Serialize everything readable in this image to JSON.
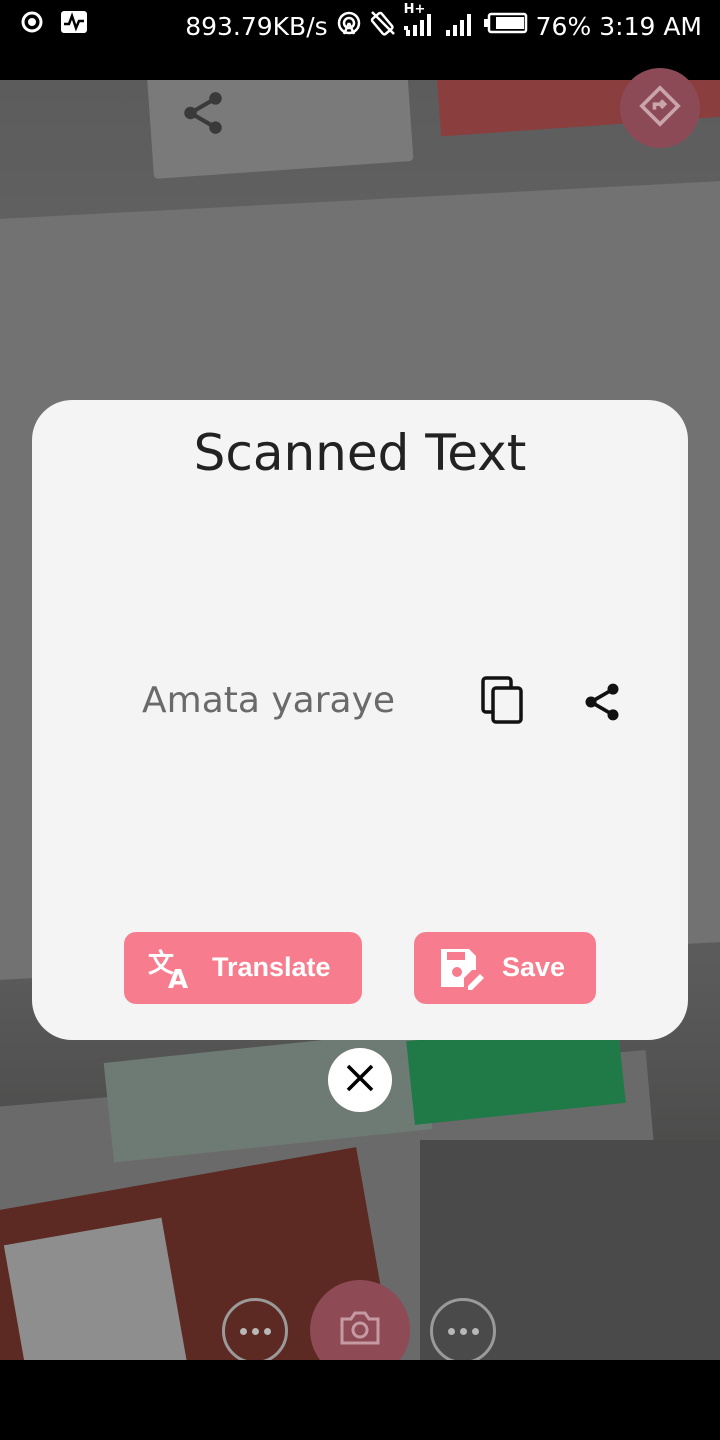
{
  "status_bar": {
    "network_speed": "893.79KB/s",
    "network_type": "H+",
    "battery": "76%",
    "time": "3:19 AM",
    "icons": [
      "record-icon",
      "activity-icon",
      "hotspot-icon",
      "rotate-icon",
      "signal-icon",
      "signal-icon",
      "battery-icon"
    ]
  },
  "dialog": {
    "title": "Scanned Text",
    "scanned_text": "Amata yaraye",
    "watermark": "Amata yaraye",
    "translate_label": "Translate",
    "save_label": "Save"
  },
  "colors": {
    "accent": "#f77d8e",
    "dialog_bg": "#f4f4f4",
    "capture": "#8e4a55"
  }
}
